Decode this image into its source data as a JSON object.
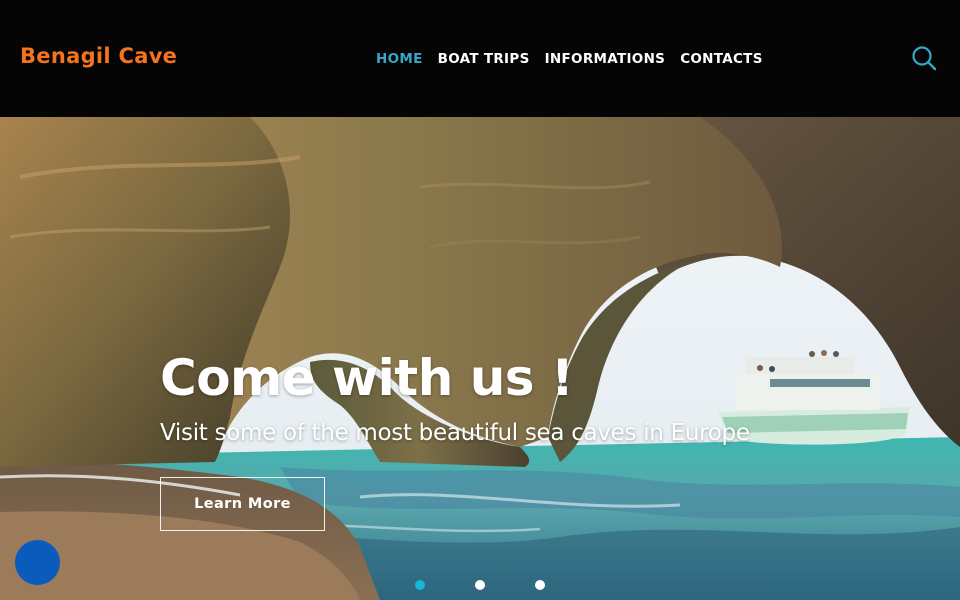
{
  "header": {
    "logo": "Benagil Cave",
    "nav": [
      "HOME",
      "BOAT TRIPS",
      "INFORMATIONS",
      "CONTACTS"
    ],
    "active_nav": "HOME",
    "search_icon": "search-icon"
  },
  "hero": {
    "title": "Come with us !",
    "subtitle": "Visit some of the most beautiful sea caves in Europe",
    "button_label": "Learn More",
    "slides": 3,
    "active_slide": 1
  },
  "colors": {
    "logo": "#f4731c",
    "nav_active": "#3aa6c9",
    "dot_active": "#19b7d6",
    "chat": "#0b5bbd"
  },
  "widgets": {
    "chat_icon": "chat-bubble-icon"
  }
}
